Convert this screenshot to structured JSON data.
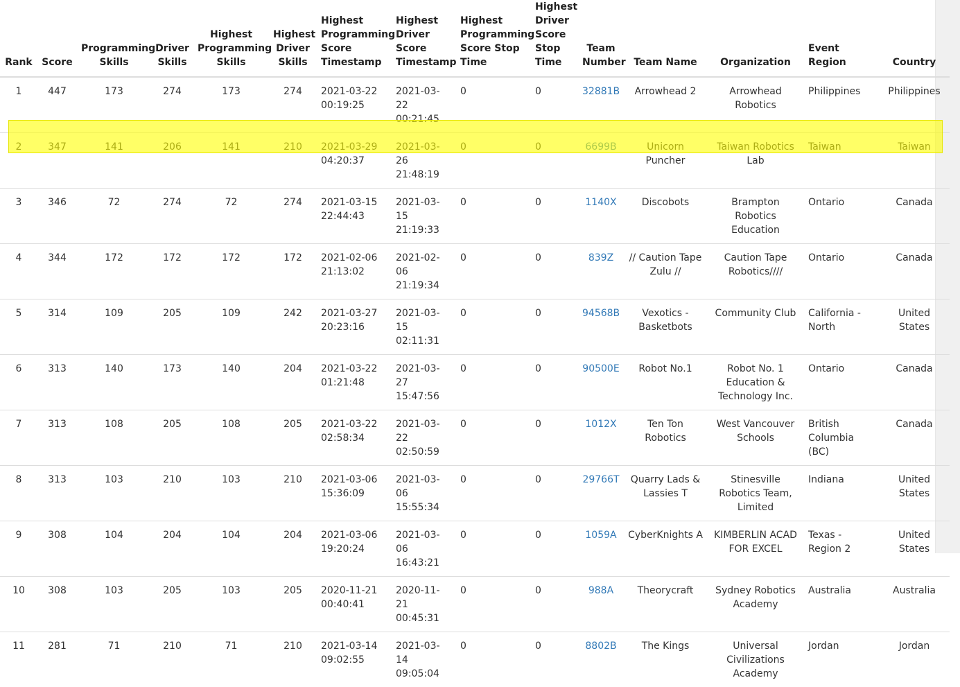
{
  "columns": [
    "Rank",
    "Score",
    "Programming Skills",
    "Driver Skills",
    "Highest Programming Skills",
    "Highest Driver Skills",
    "Highest Programming Score Timestamp",
    "Highest Driver Score Timestamp",
    "Highest Programming Score Stop Time",
    "Highest Driver Score Stop Time",
    "Team Number",
    "Team Name",
    "Organization",
    "Event Region",
    "Country"
  ],
  "rows": [
    {
      "rank": "1",
      "score": "447",
      "prog": "173",
      "driver": "274",
      "hprog": "173",
      "hdriver": "274",
      "hprog_ts": "2021-03-22 00:19:25",
      "hdriver_ts": "2021-03-22 00:21:45",
      "hprog_stop": "0",
      "hdriver_stop": "0",
      "team_number": "32881B",
      "team_name": "Arrowhead 2",
      "organization": "Arrowhead Robotics",
      "region": "Philippines",
      "country": "Philippines"
    },
    {
      "rank": "2",
      "score": "347",
      "prog": "141",
      "driver": "206",
      "hprog": "141",
      "hdriver": "210",
      "hprog_ts": "2021-03-29 04:20:37",
      "hdriver_ts": "2021-03-26 21:48:19",
      "hprog_stop": "0",
      "hdriver_stop": "0",
      "team_number": "6699B",
      "team_name": "Unicorn Puncher",
      "organization": "Taiwan Robotics Lab",
      "region": "Taiwan",
      "country": "Taiwan"
    },
    {
      "rank": "3",
      "score": "346",
      "prog": "72",
      "driver": "274",
      "hprog": "72",
      "hdriver": "274",
      "hprog_ts": "2021-03-15 22:44:43",
      "hdriver_ts": "2021-03-15 21:19:33",
      "hprog_stop": "0",
      "hdriver_stop": "0",
      "team_number": "1140X",
      "team_name": "Discobots",
      "organization": "Brampton Robotics Education",
      "region": "Ontario",
      "country": "Canada"
    },
    {
      "rank": "4",
      "score": "344",
      "prog": "172",
      "driver": "172",
      "hprog": "172",
      "hdriver": "172",
      "hprog_ts": "2021-02-06 21:13:02",
      "hdriver_ts": "2021-02-06 21:19:34",
      "hprog_stop": "0",
      "hdriver_stop": "0",
      "team_number": "839Z",
      "team_name": "// Caution Tape Zulu //",
      "organization": "Caution Tape Robotics////",
      "region": "Ontario",
      "country": "Canada"
    },
    {
      "rank": "5",
      "score": "314",
      "prog": "109",
      "driver": "205",
      "hprog": "109",
      "hdriver": "242",
      "hprog_ts": "2021-03-27 20:23:16",
      "hdriver_ts": "2021-03-15 02:11:31",
      "hprog_stop": "0",
      "hdriver_stop": "0",
      "team_number": "94568B",
      "team_name": "Vexotics - Basketbots",
      "organization": "Community Club",
      "region": "California - North",
      "country": "United States"
    },
    {
      "rank": "6",
      "score": "313",
      "prog": "140",
      "driver": "173",
      "hprog": "140",
      "hdriver": "204",
      "hprog_ts": "2021-03-22 01:21:48",
      "hdriver_ts": "2021-03-27 15:47:56",
      "hprog_stop": "0",
      "hdriver_stop": "0",
      "team_number": "90500E",
      "team_name": "Robot No.1",
      "organization": "Robot No. 1 Education & Technology Inc.",
      "region": "Ontario",
      "country": "Canada"
    },
    {
      "rank": "7",
      "score": "313",
      "prog": "108",
      "driver": "205",
      "hprog": "108",
      "hdriver": "205",
      "hprog_ts": "2021-03-22 02:58:34",
      "hdriver_ts": "2021-03-22 02:50:59",
      "hprog_stop": "0",
      "hdriver_stop": "0",
      "team_number": "1012X",
      "team_name": "Ten Ton Robotics",
      "organization": "West Vancouver Schools",
      "region": "British Columbia (BC)",
      "country": "Canada"
    },
    {
      "rank": "8",
      "score": "313",
      "prog": "103",
      "driver": "210",
      "hprog": "103",
      "hdriver": "210",
      "hprog_ts": "2021-03-06 15:36:09",
      "hdriver_ts": "2021-03-06 15:55:34",
      "hprog_stop": "0",
      "hdriver_stop": "0",
      "team_number": "29766T",
      "team_name": "Quarry Lads & Lassies T",
      "organization": "Stinesville Robotics Team, Limited",
      "region": "Indiana",
      "country": "United States"
    },
    {
      "rank": "9",
      "score": "308",
      "prog": "104",
      "driver": "204",
      "hprog": "104",
      "hdriver": "204",
      "hprog_ts": "2021-03-06 19:20:24",
      "hdriver_ts": "2021-03-06 16:43:21",
      "hprog_stop": "0",
      "hdriver_stop": "0",
      "team_number": "1059A",
      "team_name": "CyberKnights A",
      "organization": "KIMBERLIN ACAD FOR EXCEL",
      "region": "Texas - Region 2",
      "country": "United States"
    },
    {
      "rank": "10",
      "score": "308",
      "prog": "103",
      "driver": "205",
      "hprog": "103",
      "hdriver": "205",
      "hprog_ts": "2020-11-21 00:40:41",
      "hdriver_ts": "2020-11-21 00:45:31",
      "hprog_stop": "0",
      "hdriver_stop": "0",
      "team_number": "988A",
      "team_name": "Theorycraft",
      "organization": "Sydney Robotics Academy",
      "region": "Australia",
      "country": "Australia"
    },
    {
      "rank": "11",
      "score": "281",
      "prog": "71",
      "driver": "210",
      "hprog": "71",
      "hdriver": "210",
      "hprog_ts": "2021-03-14 09:02:55",
      "hdriver_ts": "2021-03-14 09:05:04",
      "hprog_stop": "0",
      "hdriver_stop": "0",
      "team_number": "8802B",
      "team_name": "The Kings",
      "organization": "Universal Civilizations Academy",
      "region": "Jordan",
      "country": "Jordan"
    }
  ],
  "highlight_color": "#ffff00",
  "link_color": "#337ab7"
}
